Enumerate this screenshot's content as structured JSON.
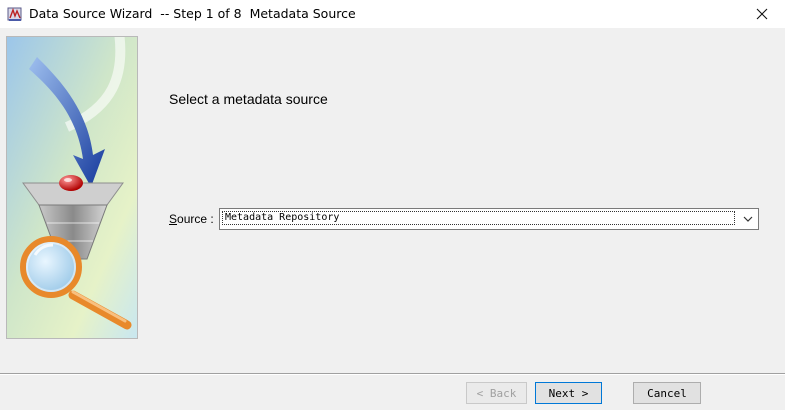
{
  "window": {
    "title": "Data Source Wizard  -- Step 1 of 8  Metadata Source",
    "close_glyph": "✕"
  },
  "main": {
    "heading": "Select a metadata source",
    "source_label_accel": "S",
    "source_label_rest": "ource :",
    "source_value": "Metadata Repository"
  },
  "buttons": {
    "back_label": "< Back",
    "next_label": "Next >",
    "cancel_label": "Cancel"
  },
  "icons": {
    "app": "wizard-app-icon",
    "close": "close-icon",
    "dropdown": "chevron-down-icon",
    "illustration": "funnel-magnifier-illustration"
  },
  "colors": {
    "next_button_border": "#0078d7",
    "arrow_blue": "#1c4fb0",
    "magnifier_orange": "#e8892b"
  }
}
